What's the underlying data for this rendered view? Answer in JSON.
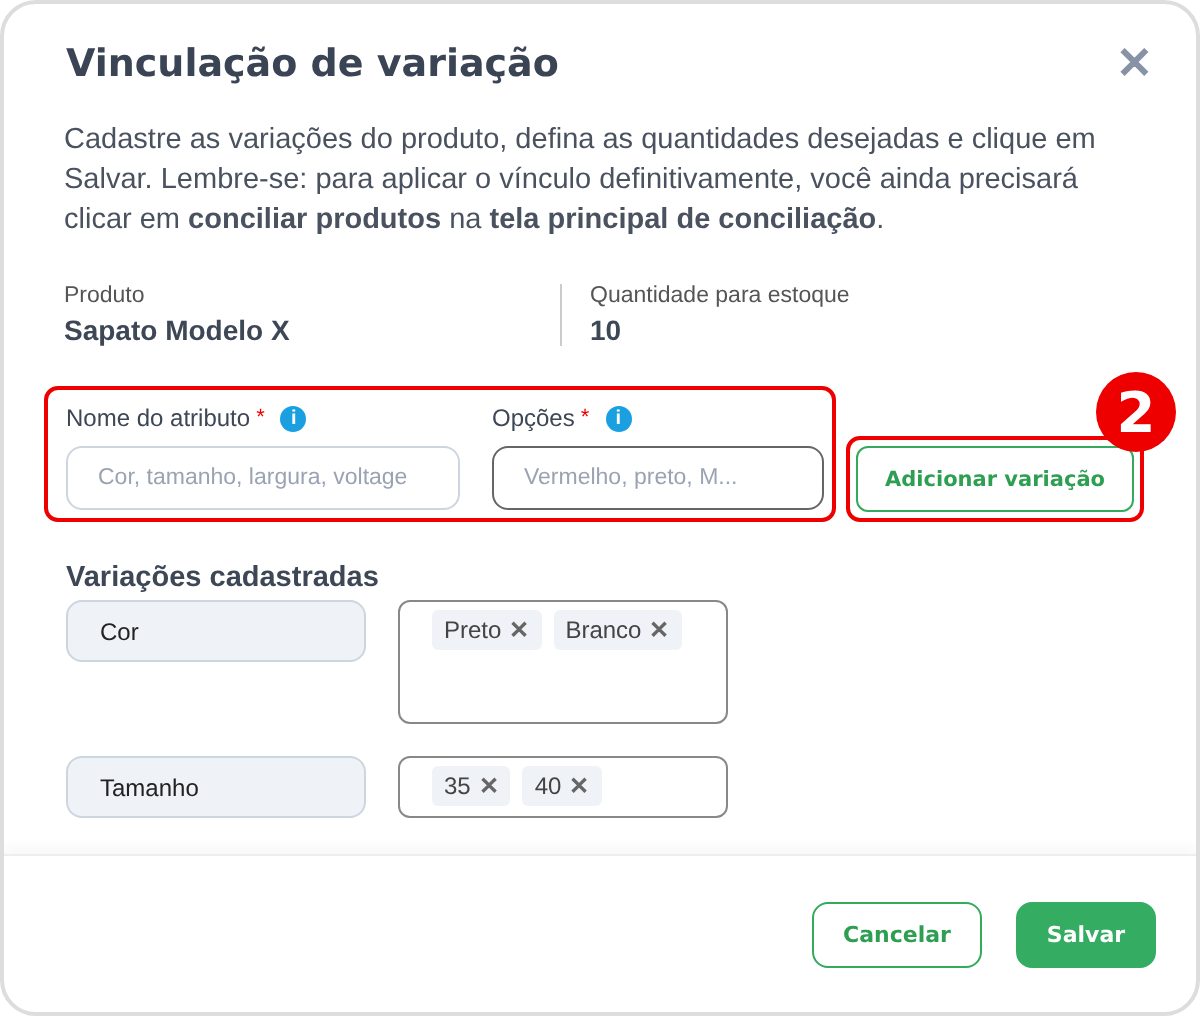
{
  "dialog": {
    "title": "Vinculação de variação",
    "close": "✕"
  },
  "description": "Cadastre as variações do produto, defina as quantidades desejadas e clique em Salvar. Lembre-se: para aplicar o vínculo definitivamente, você ainda precisará clicar em **conciliar produtos** na **tela principal de conciliação**.",
  "summary": [
    {
      "label": "Produto",
      "value": "Sapato Modelo X"
    },
    {
      "label": "Quantidade para estoque",
      "value": "10"
    }
  ],
  "form": {
    "fields": [
      {
        "label": "Nome do atributo",
        "required": "*",
        "info": "i",
        "placeholder": "Cor, tamanho, largura, voltage",
        "focused": false
      },
      {
        "label": "Opções",
        "required": "*",
        "info": "i",
        "placeholder": "Vermelho, preto, M...",
        "focused": true
      }
    ],
    "add_button": "Adicionar variação",
    "step_badge": "2"
  },
  "variations": {
    "title": "Variações cadastradas",
    "rows": [
      {
        "attribute": "Cor",
        "options": [
          {
            "label": "Preto",
            "remove": "✕"
          },
          {
            "label": "Branco",
            "remove": "✕"
          }
        ]
      },
      {
        "attribute": "Tamanho",
        "options": [
          {
            "label": "35",
            "remove": "✕"
          },
          {
            "label": "40",
            "remove": "✕"
          }
        ]
      }
    ]
  },
  "buttons": [
    {
      "label": "Cancelar",
      "kind": "secondary"
    },
    {
      "label": "Salvar",
      "kind": "primary"
    }
  ]
}
